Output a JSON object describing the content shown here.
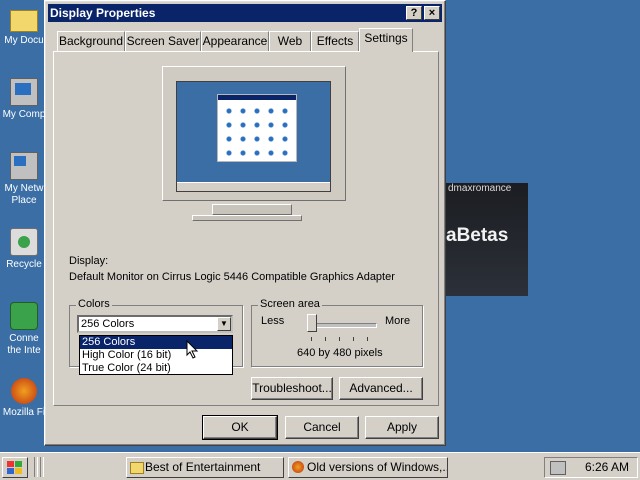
{
  "desktop": {
    "icons": [
      {
        "label1": "My Docu",
        "label2": ""
      },
      {
        "label1": "My Comp",
        "label2": ""
      },
      {
        "label1": "My Netw",
        "label2": "Place"
      },
      {
        "label1": "Recycle",
        "label2": ""
      },
      {
        "label1": "Conne",
        "label2": "the Inte"
      },
      {
        "label1": "Mozilla Fi",
        "label2": ""
      }
    ],
    "panel_text1": "dmaxromance",
    "panel_text2": "aBetas"
  },
  "dialog": {
    "title": "Display Properties",
    "help_btn": "?",
    "close_btn": "×",
    "tabs": [
      "Background",
      "Screen Saver",
      "Appearance",
      "Web",
      "Effects",
      "Settings"
    ],
    "active_tab": "Settings",
    "display_label": "Display:",
    "display_value": "Default Monitor on Cirrus Logic 5446 Compatible Graphics Adapter",
    "colors": {
      "group_label": "Colors",
      "selected": "256 Colors",
      "options": [
        "256 Colors",
        "High Color (16 bit)",
        "True Color (24 bit)"
      ]
    },
    "screen_area": {
      "group_label": "Screen area",
      "less": "Less",
      "more": "More",
      "value": "640 by 480 pixels",
      "level": 0
    },
    "buttons": {
      "troubleshoot": "Troubleshoot...",
      "advanced": "Advanced...",
      "ok": "OK",
      "cancel": "Cancel",
      "apply": "Apply"
    }
  },
  "taskbar": {
    "start_icon": "windows-logo-icon",
    "items": [
      "Best of Entertainment",
      "Old versions of Windows,..."
    ],
    "clock": "6:26 AM"
  },
  "colors": {
    "desktop": "#3a6ea5",
    "title_active": "#0a246a",
    "face": "#d4d0c8"
  }
}
